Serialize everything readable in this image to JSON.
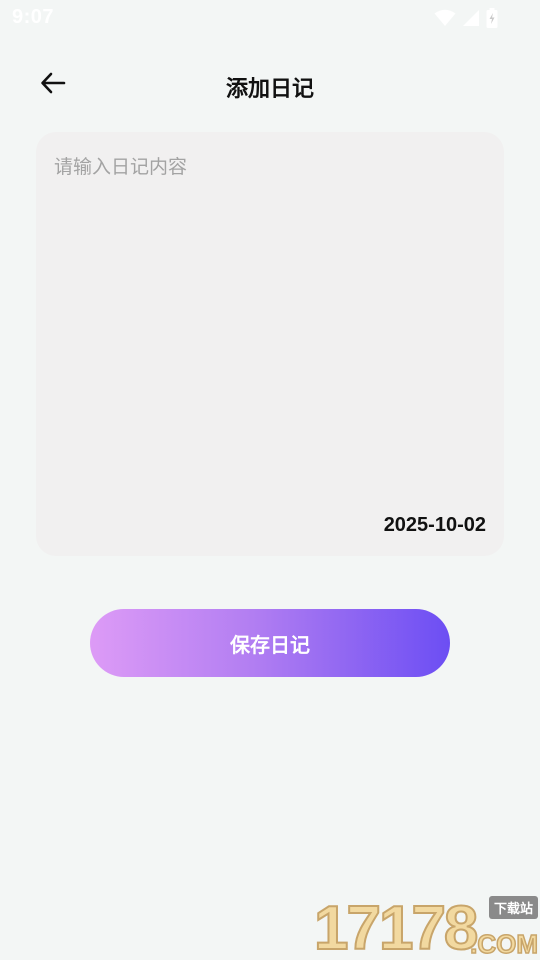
{
  "status_bar": {
    "time": "9:07",
    "icons": [
      "wifi-icon",
      "cell-signal-icon",
      "battery-charging-icon"
    ]
  },
  "header": {
    "back_icon": "arrow-left-icon",
    "title": "添加日记"
  },
  "diary": {
    "placeholder": "请输入日记内容",
    "value": "",
    "date": "2025-10-02"
  },
  "save_button": {
    "label": "保存日记"
  },
  "watermark": {
    "digits": "17178",
    "tag": "下载站",
    "domain": ".COM"
  },
  "colors": {
    "background": "#f3f6f5",
    "card": "#f1f0f0",
    "button_gradient_start": "#dd9bf6",
    "button_gradient_end": "#6c4ef3"
  }
}
